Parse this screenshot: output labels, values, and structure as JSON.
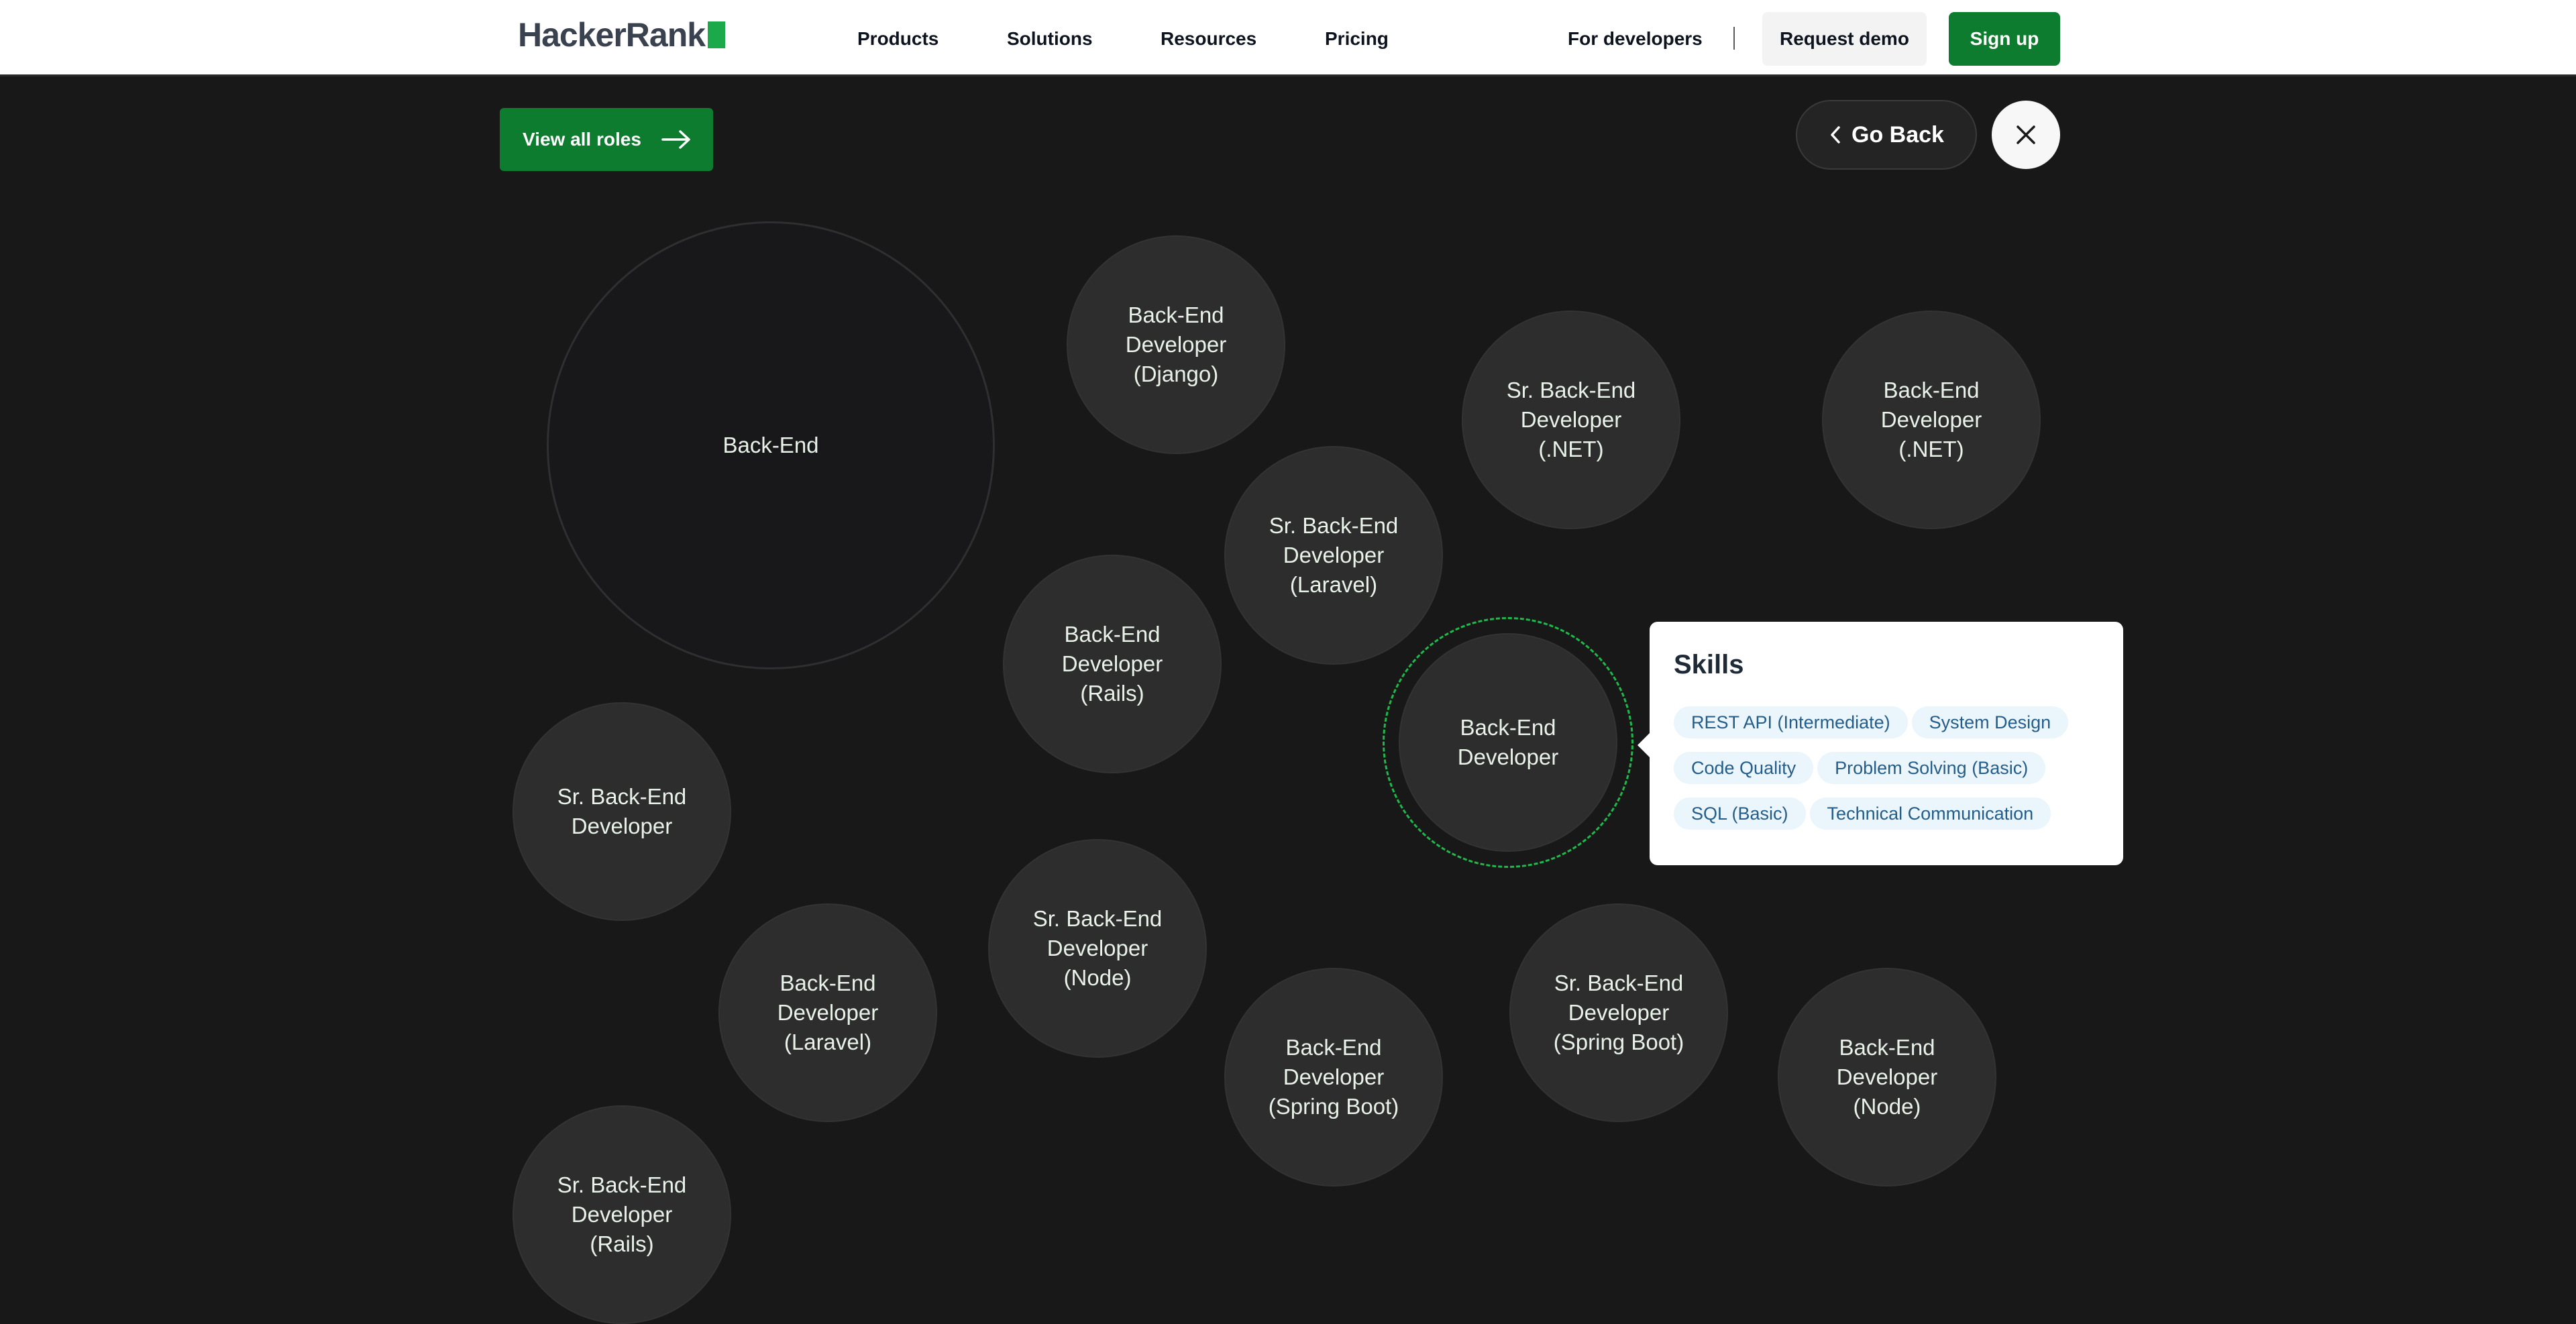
{
  "header": {
    "logo_text": "HackerRank",
    "nav_links": [
      "Products",
      "Solutions",
      "Resources",
      "Pricing"
    ],
    "for_developers": "For developers",
    "request_demo": "Request demo",
    "sign_up": "Sign up"
  },
  "actions": {
    "view_all_roles": "View all roles",
    "go_back": "Go Back"
  },
  "colors": {
    "brand_green": "#0e7c2e",
    "logo_green": "#1ba94c",
    "selected_ring": "#1fb94a",
    "background": "#181819",
    "bubble": "#2d2d2e"
  },
  "bubbles": [
    {
      "label": "Back-End",
      "type": "parent"
    },
    {
      "label": "Back-End\nDeveloper\n(Django)"
    },
    {
      "label": "Sr. Back-End\nDeveloper\n(.NET)"
    },
    {
      "label": "Back-End\nDeveloper\n(.NET)"
    },
    {
      "label": "Sr. Back-End\nDeveloper\n(Laravel)"
    },
    {
      "label": "Back-End\nDeveloper\n(Rails)"
    },
    {
      "label": "Back-End\nDeveloper",
      "selected": true
    },
    {
      "label": "Sr. Back-End\nDeveloper"
    },
    {
      "label": "Sr. Back-End\nDeveloper\n(Node)"
    },
    {
      "label": "Back-End\nDeveloper\n(Laravel)"
    },
    {
      "label": "Sr. Back-End\nDeveloper\n(Spring Boot)"
    },
    {
      "label": "Back-End\nDeveloper\n(Spring Boot)"
    },
    {
      "label": "Back-End\nDeveloper\n(Node)"
    },
    {
      "label": "Sr. Back-End\nDeveloper\n(Rails)"
    }
  ],
  "skills_popover": {
    "title": "Skills",
    "skills": [
      "REST API (Intermediate)",
      "System Design",
      "Code Quality",
      "Problem Solving (Basic)",
      "SQL (Basic)",
      "Technical Communication"
    ]
  }
}
